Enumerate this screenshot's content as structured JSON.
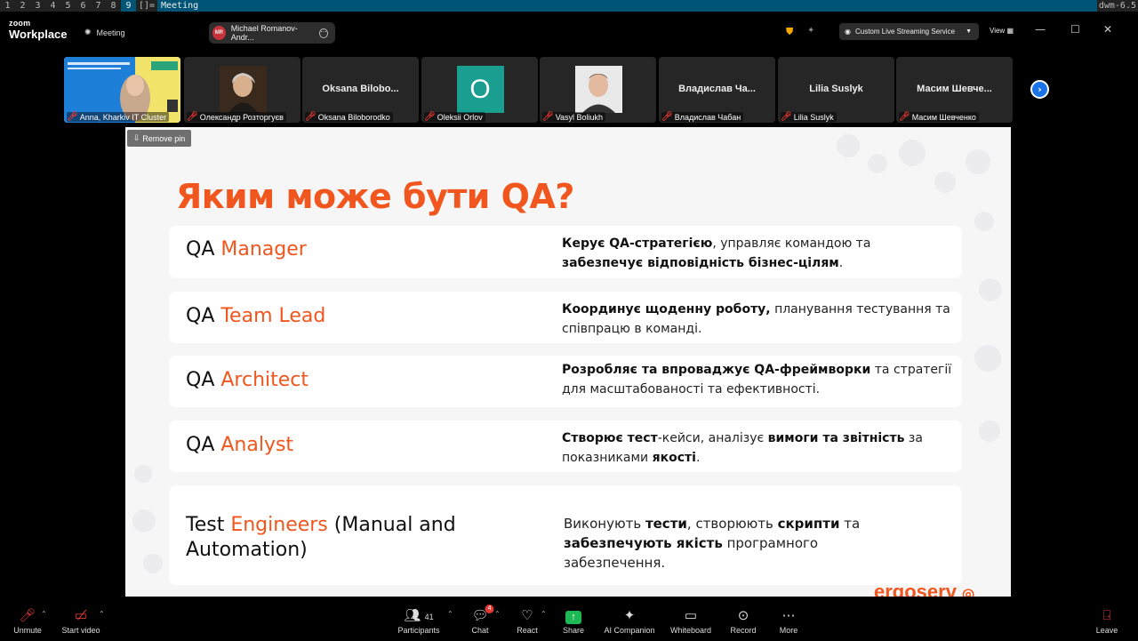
{
  "dwm": {
    "tags": [
      "1",
      "2",
      "3",
      "4",
      "5",
      "6",
      "7",
      "8",
      "9"
    ],
    "selected_tag": "9",
    "layout": "[]=",
    "window_title": "Meeting",
    "status": "dwm-6.5"
  },
  "topbar": {
    "logo_small": "zoom",
    "logo_big": "Workplace",
    "meeting_label": "Meeting",
    "sharer_initials": "MR",
    "sharer_name": "Michael Romanov-Andr...",
    "stream_label": "Custom Live Streaming Service",
    "view_label": "View",
    "colors": {
      "stream_bg": "#2d2d2d",
      "shield": "#f2a900"
    }
  },
  "participants": [
    {
      "label": "Anna, Kharkiv IT Cluster",
      "type": "video"
    },
    {
      "label": "Олександр Розторгуєв",
      "type": "photo"
    },
    {
      "label": "Oksana Biloborodko",
      "display": "Oksana Bilobo...",
      "type": "name"
    },
    {
      "label": "Oleksii Orlov",
      "avatar": "O",
      "type": "avatar",
      "avatar_color": "#1a9e8f"
    },
    {
      "label": "Vasyl Boliukh",
      "type": "photo"
    },
    {
      "label": "Владислав Чабан",
      "display": "Владислав Ча...",
      "type": "name"
    },
    {
      "label": "Lilia Suslyk",
      "display": "Lilia Suslyk",
      "type": "name"
    },
    {
      "label": "Масим Шевченко",
      "display": "Масим Шевче...",
      "type": "name"
    }
  ],
  "slide": {
    "remove_pin": "Remove pin",
    "title": "Яким може бути QA?",
    "brand": "ergoserv",
    "accent_color": "#f0561d",
    "cards": [
      {
        "role_prefix": "QA ",
        "role_accent": "Manager",
        "role_suffix": "",
        "desc": [
          {
            "b": "Керує QA-стратегією"
          },
          {
            "t": ", управляє командою та "
          },
          {
            "b": "забезпечує відповідність бізнес-цілям"
          },
          {
            "t": "."
          }
        ]
      },
      {
        "role_prefix": "QA ",
        "role_accent": "Team Lead",
        "role_suffix": "",
        "desc": [
          {
            "b": "Координує щоденну роботу,"
          },
          {
            "t": " планування тестування та співпрацю в команді."
          }
        ]
      },
      {
        "role_prefix": "QA ",
        "role_accent": "Architect",
        "role_suffix": "",
        "desc": [
          {
            "b": "Розробляє та впроваджує QA-фреймворки"
          },
          {
            "t": " та стратегії для масштабованості та ефективності."
          }
        ]
      },
      {
        "role_prefix": "QA ",
        "role_accent": "Analyst",
        "role_suffix": "",
        "desc": [
          {
            "b": "Створює тест"
          },
          {
            "t": "-кейси, аналізує "
          },
          {
            "b": "вимоги та звітність"
          },
          {
            "t": " за показниками "
          },
          {
            "b": "якості"
          },
          {
            "t": "."
          }
        ]
      },
      {
        "role_prefix": "Test ",
        "role_accent": "Engineers",
        "role_suffix": " (Manual and Automation)",
        "desc": [
          {
            "t": "Виконують "
          },
          {
            "b": "тести"
          },
          {
            "t": ", створюють "
          },
          {
            "b": "скрипти"
          },
          {
            "t": " та "
          },
          {
            "b": "забезпечують якість"
          },
          {
            "t": " програмного забезпечення."
          }
        ]
      }
    ]
  },
  "toolbar": {
    "unmute": "Unmute",
    "start_video": "Start video",
    "participants": "Participants",
    "participants_count": "41",
    "chat": "Chat",
    "chat_badge": "4",
    "react": "React",
    "share": "Share",
    "ai_companion": "AI Companion",
    "whiteboard": "Whiteboard",
    "record": "Record",
    "more": "More",
    "leave": "Leave"
  }
}
